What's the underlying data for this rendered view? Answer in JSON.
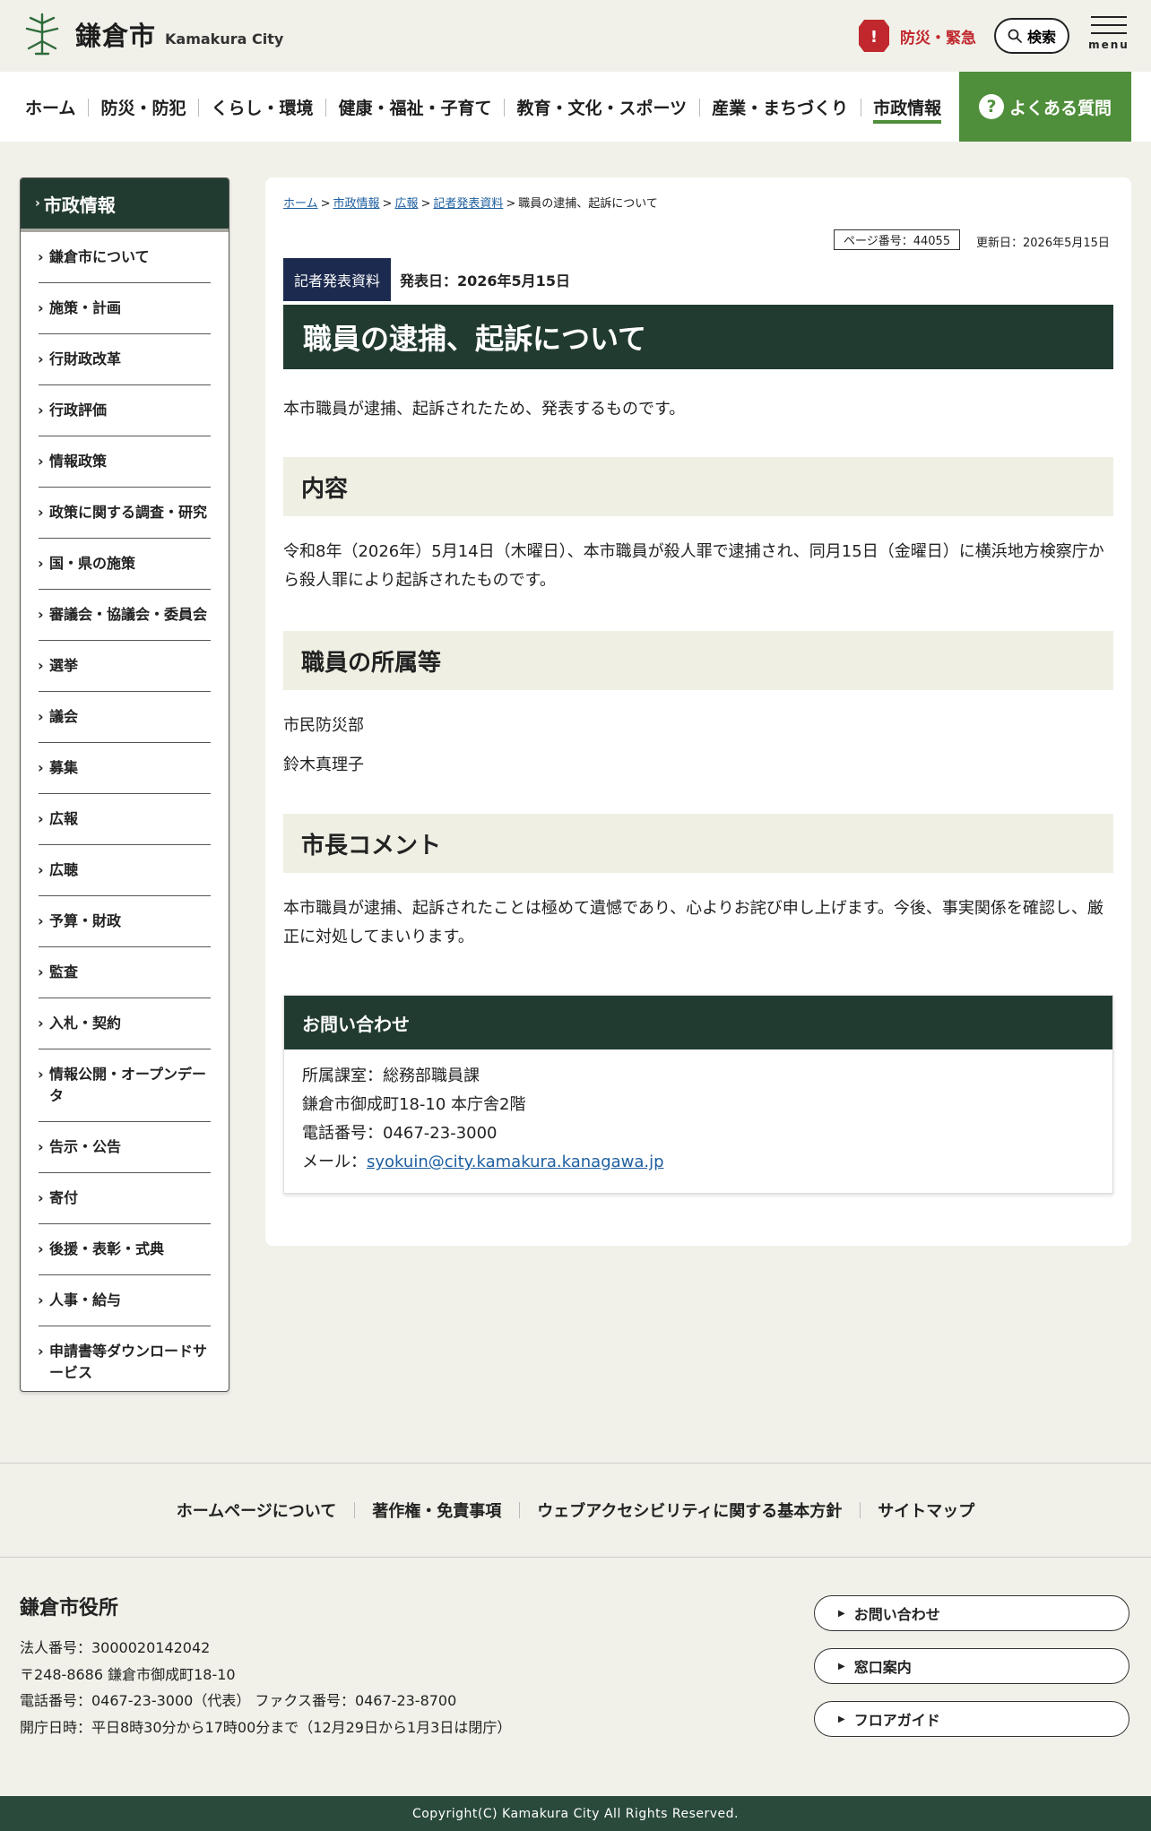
{
  "header": {
    "logo_ja": "鎌倉市",
    "logo_en": "Kamakura City",
    "emergency_label": "防災・緊急",
    "emergency_mark": "!",
    "search_label": "検索",
    "menu_label": "menu"
  },
  "nav": {
    "items": [
      "ホーム",
      "防災・防犯",
      "くらし・環境",
      "健康・福祉・子育て",
      "教育・文化・スポーツ",
      "産業・まちづくり",
      "市政情報"
    ],
    "active": "市政情報",
    "faq_mark": "?",
    "faq_label": "よくある質問"
  },
  "sidebar": {
    "title": "市政情報",
    "items": [
      "鎌倉市について",
      "施策・計画",
      "行財政改革",
      "行政評価",
      "情報政策",
      "政策に関する調査・研究",
      "国・県の施策",
      "審議会・協議会・委員会",
      "選挙",
      "議会",
      "募集",
      "広報",
      "広聴",
      "予算・財政",
      "監査",
      "入札・契約",
      "情報公開・オープンデータ",
      "告示・公告",
      "寄付",
      "後援・表彰・式典",
      "人事・給与",
      "申請書等ダウンロードサービス"
    ]
  },
  "breadcrumb": {
    "items": [
      "ホーム",
      "市政情報",
      "広報",
      "記者発表資料"
    ],
    "current": "職員の逮捕、起訴について",
    "separator": ">"
  },
  "page_meta": {
    "page_number": "ページ番号：44055",
    "updated": "更新日：2026年5月15日"
  },
  "article": {
    "badge": "記者発表資料",
    "published": "発表日：2026年5月15日",
    "title": "職員の逮捕、起訴について",
    "lead": "本市職員が逮捕、起訴されたため、発表するものです。",
    "sections": [
      {
        "heading": "内容",
        "paragraphs": [
          "令和8年（2026年）5月14日（木曜日）、本市職員が殺人罪で逮捕され、同月15日（金曜日）に横浜地方検察庁から殺人罪により起訴されたものです。"
        ]
      },
      {
        "heading": "職員の所属等",
        "paragraphs": [
          "市民防災部",
          "鈴木真理子"
        ]
      },
      {
        "heading": "市長コメント",
        "paragraphs": [
          "本市職員が逮捕、起訴されたことは極めて遺憾であり、心よりお詫び申し上げます。今後、事実関係を確認し、厳正に対処してまいります。"
        ]
      }
    ]
  },
  "contact": {
    "heading": "お問い合わせ",
    "dept": "所属課室：総務部職員課",
    "address": "鎌倉市御成町18-10 本庁舎2階",
    "phone": "電話番号：0467-23-3000",
    "email_label": "メール：",
    "email": "syokuin@city.kamakura.kanagawa.jp"
  },
  "footer": {
    "links": [
      "ホームページについて",
      "著作権・免責事項",
      "ウェブアクセシビリティに関する基本方針",
      "サイトマップ"
    ],
    "org_name": "鎌倉市役所",
    "info": [
      "法人番号：3000020142042",
      "〒248-8686 鎌倉市御成町18-10",
      "電話番号：0467-23-3000（代表） ファクス番号：0467-23-8700",
      "開庁日時：平日8時30分から17時00分まで（12月29日から1月3日は閉庁）"
    ],
    "buttons": [
      "お問い合わせ",
      "窓口案内",
      "フロアガイド"
    ],
    "copyright": "Copyright(C) Kamakura City All Rights Reserved."
  },
  "colors": {
    "dark_green": "#223b30",
    "accent_green": "#4f8e3a",
    "emergency_red": "#c0282d",
    "badge_navy": "#1c2a4f",
    "link_blue": "#1e5fa0"
  }
}
